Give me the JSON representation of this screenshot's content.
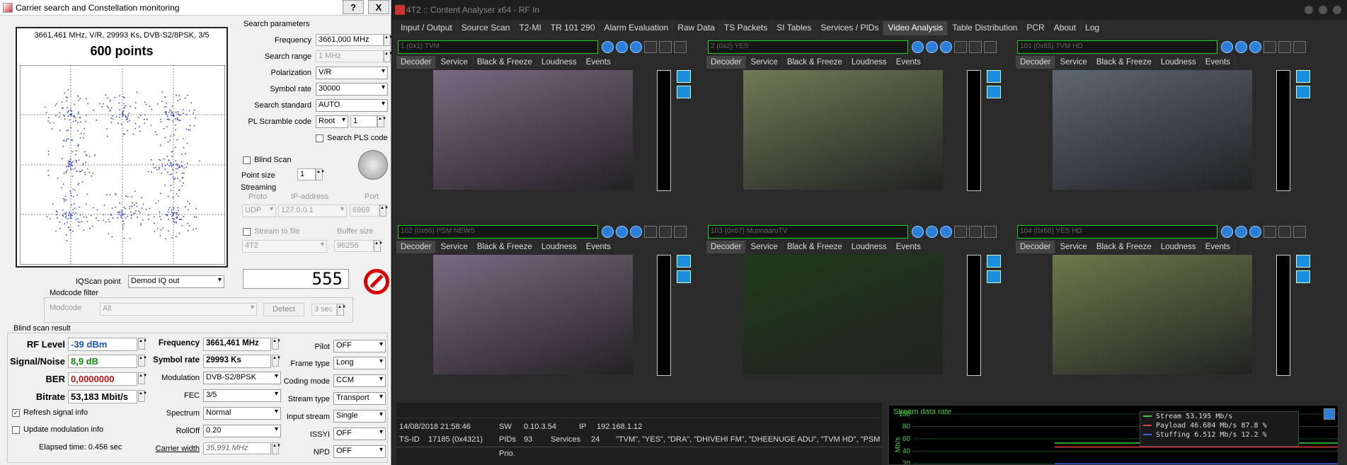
{
  "left_window": {
    "title": "Carrier search and Constellation monitoring",
    "btn_help": "?",
    "btn_close": "X",
    "constellation": {
      "info": "3661,461 MHz, V/R, 29993 Ks, DVB-S2/8PSK, 3/5",
      "points": "600 points"
    },
    "search_params": {
      "title": "Search parameters",
      "frequency_label": "Frequency",
      "frequency_value": "3661,000 MHz",
      "search_range_label": "Search range",
      "search_range_value": "1 MHz",
      "polarization_label": "Polarization",
      "polarization_value": "V/R",
      "symbol_rate_label": "Symbol rate",
      "symbol_rate_value": "30000",
      "search_standard_label": "Search standard",
      "search_standard_value": "AUTO",
      "pl_scramble_label": "PL Scramble code",
      "pl_scramble_type": "Root",
      "pl_scramble_value": "1",
      "search_pls_label": "Search PLS code",
      "blind_scan_label": "Blind Scan",
      "point_size_label": "Point size",
      "point_size_value": "1"
    },
    "streaming": {
      "title": "Streaming",
      "proto_label": "Proto",
      "proto_value": "UDP",
      "ip_label": "IP-address",
      "ip_value": "127.0.0.1",
      "port_label": "Port",
      "port_value": "6969",
      "stream_to_file_label": "Stream to file",
      "buffer_size_label": "Buffer size",
      "buffer_size_value": "96256",
      "file_value": "4T2"
    },
    "counter": "555",
    "iqscan": {
      "label": "IQScan point",
      "value": "Demod IQ out"
    },
    "modcode_filter": {
      "title": "Modcode filter",
      "label": "Modcode",
      "value": "All",
      "detect": "Detect",
      "seconds": "3 sec"
    },
    "result": {
      "title": "Blind scan result",
      "rf_level_label": "RF Level",
      "rf_level_value": "-39 dBm",
      "snr_label": "Signal/Noise",
      "snr_value": "8,9 dB",
      "ber_label": "BER",
      "ber_value": "0,0000000",
      "bitrate_label": "Bitrate",
      "bitrate_value": "53,183 Mbit/s",
      "refresh_label": "Refresh signal info",
      "update_mod_label": "Update modulation info",
      "elapsed": "Elapsed time: 0.456 sec",
      "frequency_label": "Frequency",
      "frequency_value": "3661,461 MHz",
      "symbol_rate_label": "Symbol rate",
      "symbol_rate_value": "29993 Ks",
      "modulation_label": "Modulation",
      "modulation_value": "DVB-S2/8PSK",
      "fec_label": "FEC",
      "fec_value": "3/5",
      "spectrum_label": "Spectrum",
      "spectrum_value": "Normal",
      "rolloff_label": "RollOff",
      "rolloff_value": "0.20",
      "carrier_width_label": "Carrier width",
      "carrier_width_value": "35,991 MHz",
      "pilot_label": "Pilot",
      "pilot_value": "OFF",
      "frame_type_label": "Frame type",
      "frame_type_value": "Long",
      "coding_mode_label": "Coding mode",
      "coding_mode_value": "CCM",
      "stream_type_label": "Stream type",
      "stream_type_value": "Transport",
      "input_stream_label": "Input stream",
      "input_stream_value": "Single",
      "issyi_label": "ISSYI",
      "issyi_value": "OFF",
      "npd_label": "NPD",
      "npd_value": "OFF"
    }
  },
  "right_window": {
    "title": "4T2 :: Content Analyser x64 - RF In",
    "menu": [
      "Input / Output",
      "Source Scan",
      "T2-MI",
      "TR 101 290",
      "Alarm Evaluation",
      "Raw Data",
      "TS Packets",
      "SI Tables",
      "Services / PIDs",
      "Video Analysis",
      "Table Distribution",
      "PCR",
      "About",
      "Log"
    ],
    "subtabs": [
      "Decoder",
      "Service",
      "Black & Freeze",
      "Loudness",
      "Events"
    ],
    "channels": [
      {
        "name": "1 (0x1) TVM",
        "color": "#7a6a80"
      },
      {
        "name": "2 (0x2) YES",
        "color": "#6f7a55"
      },
      {
        "name": "101 (0x65) TVM HD",
        "color": "#5e6670"
      },
      {
        "name": "102 (0x66) PSM NEWS",
        "color": "#7a6a80"
      },
      {
        "name": "103 (0x67) MunnaaruTV",
        "color": "#1f3a1a"
      },
      {
        "name": "104 (0x68) YES HD",
        "color": "#6b7a4a"
      }
    ],
    "status": {
      "datetime": "14/08/2018 21:58:46",
      "sw_label": "SW",
      "sw_value": "0.10.3.54",
      "ip_label": "IP",
      "ip_value": "192.168.1.12",
      "tsid_label": "TS-ID",
      "tsid_value": "17185 (0x4321)",
      "pids_label": "PIDs",
      "pids_value": "93",
      "services_label": "Services",
      "services_value": "24",
      "services_list": "\"TVM\", \"YES\", \"DRA\", \"DHIVEHI FM\", \"DHEENUGE ADU\", \"TVM HD\", \"PSM NEWS\"",
      "prio": "Prio."
    },
    "chart": {
      "title": "Stream data rate",
      "ylabel": "Mb/s",
      "legend": [
        {
          "name": "Stream",
          "value": "53.195 Mb/s",
          "pct": ""
        },
        {
          "name": "Payload",
          "value": "46.684 Mb/s",
          "pct": "87.8 %"
        },
        {
          "name": "Stuffing",
          "value": "6.512 Mb/s",
          "pct": "12.2 %"
        }
      ],
      "ticks": [
        "100",
        "80",
        "60",
        "40",
        "20"
      ]
    }
  },
  "chart_data": {
    "type": "line",
    "title": "Stream data rate",
    "ylabel": "Mb/s",
    "ylim": [
      20,
      100
    ],
    "y_ticks": [
      100,
      80,
      60,
      40,
      20
    ],
    "series": [
      {
        "name": "Stream",
        "values": [
          53.195,
          53.195,
          53.195,
          53.195
        ]
      },
      {
        "name": "Payload",
        "values": [
          46.684,
          46.684,
          46.684,
          46.684
        ]
      },
      {
        "name": "Stuffing",
        "values": [
          6.512,
          6.512,
          6.512,
          6.512
        ]
      }
    ]
  }
}
